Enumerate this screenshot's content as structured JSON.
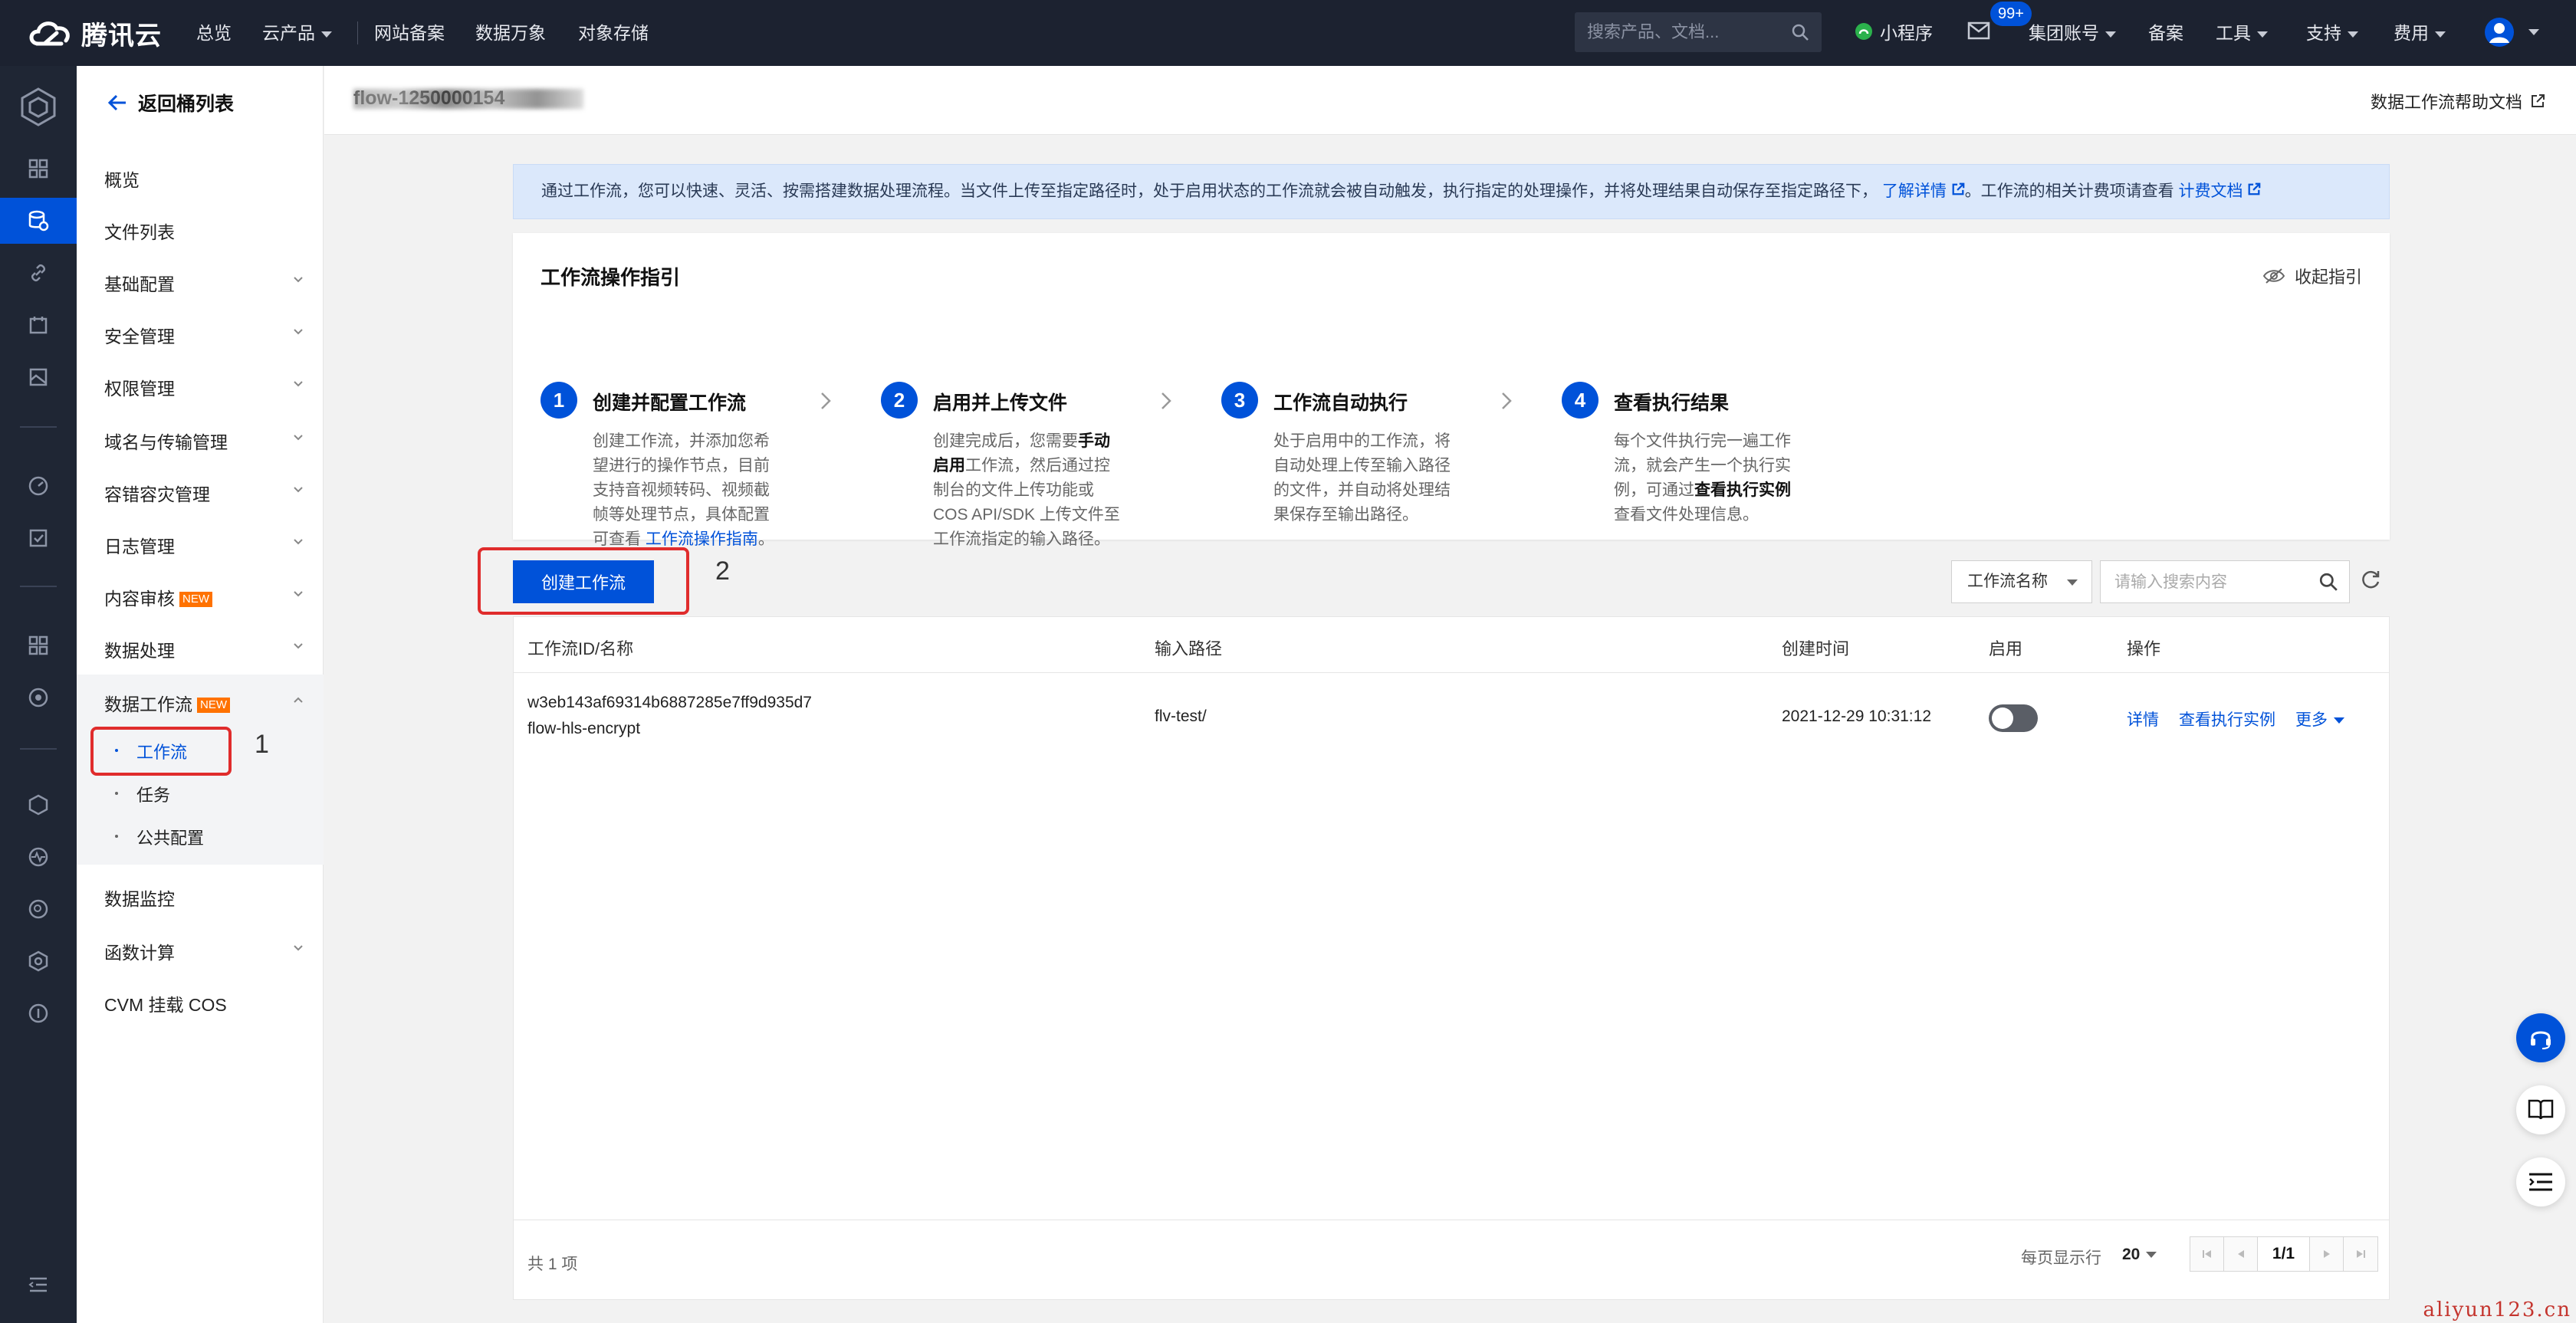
{
  "topbar": {
    "brand": "腾讯云",
    "nav": [
      "总览",
      "云产品",
      "网站备案",
      "数据万象",
      "对象存储"
    ],
    "search_placeholder": "搜索产品、文档...",
    "mini_program": "小程序",
    "message_badge": "99+",
    "account": "集团账号",
    "right_nav": [
      "备案",
      "工具",
      "支持",
      "费用"
    ]
  },
  "menu": {
    "back_label": "返回桶列表",
    "items": [
      "概览",
      "文件列表",
      "基础配置",
      "安全管理",
      "权限管理",
      "域名与传输管理",
      "容错容灾管理",
      "日志管理",
      "内容审核",
      "数据处理",
      "数据工作流",
      "数据监控",
      "函数计算",
      "CVM 挂载 COS"
    ],
    "new_tag": "NEW",
    "sub_items": [
      "工作流",
      "任务",
      "公共配置"
    ]
  },
  "annotations": {
    "one": "1",
    "two": "2"
  },
  "header": {
    "bucket_name": "flow-1250000154",
    "help_link": "数据工作流帮助文档"
  },
  "info": {
    "text": "通过工作流，您可以快速、灵活、按需搭建数据处理流程。当文件上传至指定路径时，处于启用状态的工作流就会被自动触发，执行指定的处理操作，并将处理结果自动保存至指定路径下，",
    "learn_more": "了解详情",
    "text2": "。工作流的相关计费项请查看",
    "billing_link": "计费文档"
  },
  "guide": {
    "title": "工作流操作指引",
    "collapse": "收起指引",
    "steps": [
      {
        "num": "1",
        "title": "创建并配置工作流",
        "desc_a": "创建工作流，并添加您希望进行的操作节点，目前支持音视频转码、视频截帧等处理节点，具体配置可查看 ",
        "desc_link": "工作流操作指南",
        "desc_b": "。"
      },
      {
        "num": "2",
        "title": "启用并上传文件",
        "desc_a": "创建完成后，您需要",
        "desc_bold": "手动启用",
        "desc_b": "工作流，然后通过控制台的文件上传功能或 COS API/SDK 上传文件至工作流指定的输入路径。"
      },
      {
        "num": "3",
        "title": "工作流自动执行",
        "desc_a": "处于启用中的工作流，将自动处理上传至输入路径的文件，并自动将处理结果保存至输出路径。"
      },
      {
        "num": "4",
        "title": "查看执行结果",
        "desc_a": "每个文件执行完一遍工作流，就会产生一个执行实例，可通过",
        "desc_bold": "查看执行实例",
        "desc_b": "查看文件处理信息。"
      }
    ]
  },
  "toolbar": {
    "create_label": "创建工作流",
    "filter_label": "工作流名称",
    "search_placeholder": "请输入搜索内容"
  },
  "table": {
    "columns": [
      "工作流ID/名称",
      "输入路径",
      "创建时间",
      "启用",
      "操作"
    ],
    "rows": [
      {
        "id": "w3eb143af69314b6887285e7ff9d935d7",
        "name": "flow-hls-encrypt",
        "path": "flv-test/",
        "created": "2021-12-29 10:31:12",
        "enabled": false,
        "actions": [
          "详情",
          "查看执行实例",
          "更多"
        ]
      }
    ],
    "total": "共 1 项",
    "per_page_label": "每页显示行",
    "per_page": "20",
    "page": "1/1"
  },
  "watermark": "aliyun123.cn",
  "colors": {
    "primary": "#0052d9",
    "topbar": "#1c2230",
    "highlight": "#e02c2c"
  }
}
